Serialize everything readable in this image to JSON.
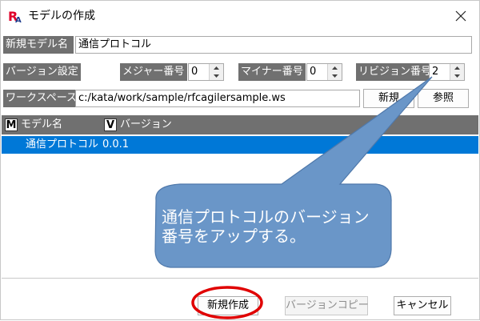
{
  "window": {
    "title": "モデルの作成",
    "icon": "ra-app-icon",
    "close_icon": "close-icon"
  },
  "form": {
    "model_name_label": "新規モデル名",
    "model_name_value": "通信プロトコル",
    "version_label": "バージョン設定",
    "major_label": "メジャー番号",
    "major_value": "0",
    "minor_label": "マイナー番号",
    "minor_value": "0",
    "revision_label": "リビジョン番号",
    "revision_value": "2",
    "workspace_label": "ワークスペース",
    "workspace_value": "c:/kata/work/sample/rfcagilersample.ws",
    "new_button": "新規",
    "browse_button": "参照"
  },
  "list": {
    "header_model_icon": "M",
    "header_model": "モデル名",
    "header_version_icon": "V",
    "header_version": "バージョン",
    "rows": [
      {
        "model": "通信プロトコル",
        "version": "0.0.1",
        "selected": true
      }
    ]
  },
  "callout": {
    "line1": "通信プロトコルのバージョン",
    "line2": "番号をアップする。",
    "fill": "#6a96c8"
  },
  "footer": {
    "create_button": "新規作成",
    "version_copy_button": "バージョンコピー",
    "cancel_button": "キャンセル"
  },
  "colors": {
    "label_bg": "#707070",
    "selection": "#0078d7",
    "highlight": "#e00000"
  }
}
